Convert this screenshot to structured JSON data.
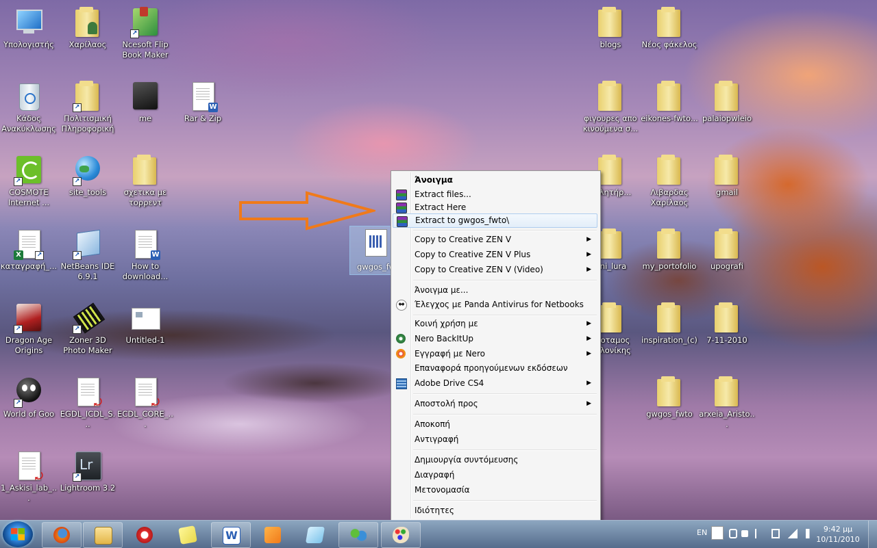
{
  "desktop": {
    "icons_left": [
      {
        "label": "Υπολογιστής"
      },
      {
        "label": "Χαρίλαος"
      },
      {
        "label": "Ncesoft Flip Book Maker"
      },
      {
        "label": "Κάδος Ανακύκλωσης"
      },
      {
        "label": "Πολιτισμική Πληροφορική"
      },
      {
        "label": "me"
      },
      {
        "label": "Rar & Zip"
      },
      {
        "label": "COSMOTE Internet ..."
      },
      {
        "label": "site_tools"
      },
      {
        "label": "σχετικα με τορρεντ"
      },
      {
        "label": "καταγραφή_..."
      },
      {
        "label": "NetBeans IDE 6.9.1"
      },
      {
        "label": "How to download..."
      },
      {
        "label": "Dragon Age Origins"
      },
      {
        "label": "Zoner 3D Photo Maker"
      },
      {
        "label": "Untitled-1"
      },
      {
        "label": "World of Goo"
      },
      {
        "label": "EGDL_ICDL_S..."
      },
      {
        "label": "ECDL_CORE_..."
      },
      {
        "label": "1_Askisi_lab_..."
      },
      {
        "label": "Lightroom 3.2"
      }
    ],
    "icons_right": [
      {
        "label": "blogs"
      },
      {
        "label": "Νέος φάκελος"
      },
      {
        "label": "φιγουρες απο κινούμενα σ..."
      },
      {
        "label": "eikones-fwto..."
      },
      {
        "label": "palaiopwleio"
      },
      {
        "label": "σκλητήρ..."
      },
      {
        "label": "Λιβαρδας Χαρίλαος"
      },
      {
        "label": "gmail"
      },
      {
        "label": "rini_lura"
      },
      {
        "label": "my_portofolio"
      },
      {
        "label": "upografi"
      },
      {
        "label": "οποταμος σαλονίκης"
      },
      {
        "label": "inspiration_(c)"
      },
      {
        "label": "7-11-2010"
      },
      {
        "label": "gwgos_fwto"
      },
      {
        "label": "arxeia_Aristo..."
      }
    ],
    "dragged_file": {
      "label": "gwgos_fw"
    }
  },
  "context_menu": {
    "items": [
      {
        "label": "Άνοιγμα",
        "bold": true
      },
      {
        "label": "Extract files...",
        "icon": "winrar-icon"
      },
      {
        "label": "Extract Here",
        "icon": "winrar-icon"
      },
      {
        "label": "Extract to gwgos_fwto\\",
        "icon": "winrar-icon",
        "highlighted": true
      },
      {
        "label": "Copy to Creative ZEN V",
        "submenu": true
      },
      {
        "label": "Copy to Creative ZEN V Plus",
        "submenu": true
      },
      {
        "label": "Copy to Creative ZEN V (Video)",
        "submenu": true
      },
      {
        "label": "Άνοιγμα με..."
      },
      {
        "label": "Έλεγχος με Panda Antivirus for Netbooks",
        "icon": "panda-icon"
      },
      {
        "label": "Κοινή χρήση με",
        "submenu": true
      },
      {
        "label": "Nero BackItUp",
        "icon": "nero-backitup-icon",
        "submenu": true
      },
      {
        "label": "Εγγραφή με Nero",
        "icon": "nero-burn-icon",
        "submenu": true
      },
      {
        "label": "Επαναφορά προηγούμενων εκδόσεων"
      },
      {
        "label": "Adobe Drive CS4",
        "icon": "adobe-drive-icon",
        "submenu": true
      },
      {
        "label": "Αποστολή προς",
        "submenu": true
      },
      {
        "label": "Αποκοπή"
      },
      {
        "label": "Αντιγραφή"
      },
      {
        "label": "Δημιουργία συντόμευσης"
      },
      {
        "label": "Διαγραφή"
      },
      {
        "label": "Μετονομασία"
      },
      {
        "label": "Ιδιότητες"
      }
    ],
    "submenu_glyph": "▶"
  },
  "taskbar": {
    "pinned": [
      "firefox-icon",
      "explorer-icon",
      "shutdown-app-icon",
      "sticky-notes-icon",
      "word-icon",
      "media-player-icon",
      "notepad-icon",
      "messenger-icon",
      "paint-icon"
    ],
    "tray": {
      "language": "EN",
      "time": "9:42 μμ",
      "date": "10/11/2010"
    }
  }
}
